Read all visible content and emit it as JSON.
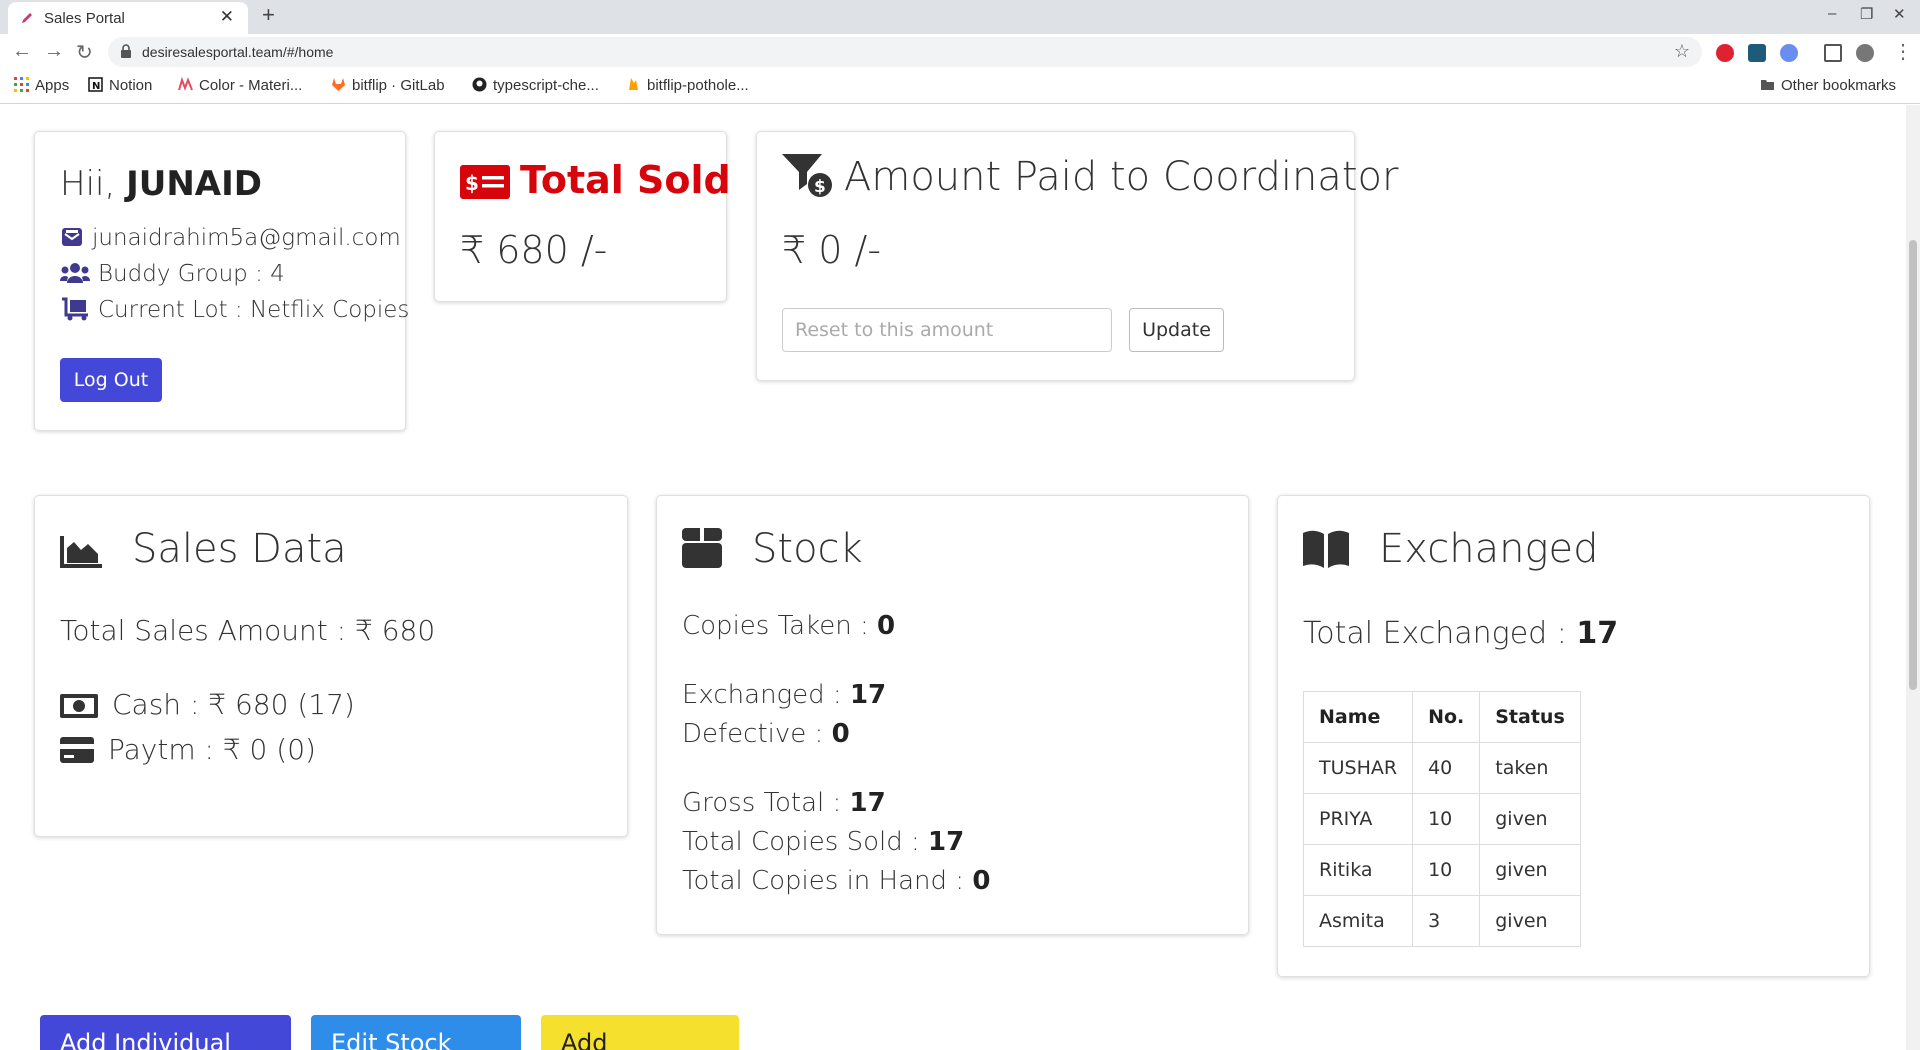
{
  "browser": {
    "tab_title": "Sales Portal",
    "tab_close": "✕",
    "new_tab": "+",
    "url": "desiresalesportal.team/#/home",
    "window_controls": [
      "–",
      "❐",
      "✕"
    ],
    "bookmarks": [
      {
        "label": "Apps",
        "icon": "apps-grid-icon"
      },
      {
        "label": "Notion",
        "icon": "notion-icon"
      },
      {
        "label": "Color - Materi...",
        "icon": "material-color-icon"
      },
      {
        "label": "bitflip · GitLab",
        "icon": "gitlab-icon"
      },
      {
        "label": "typescript-che...",
        "icon": "github-icon"
      },
      {
        "label": "bitflip-pothole...",
        "icon": "firebase-icon"
      }
    ],
    "other_bookmarks": "Other bookmarks"
  },
  "greeting": {
    "prefix": "Hii, ",
    "name": "JUNAID",
    "email": "junaidrahim5a@gmail.com",
    "buddy_group": "Buddy Group : 4",
    "current_lot": "Current Lot : Netflix Copies",
    "logout_label": "Log Out"
  },
  "total_sold": {
    "title": "Total Sold",
    "amount": "₹ 680 /-"
  },
  "coordinator": {
    "title": "Amount Paid to Coordinator",
    "amount": "₹ 0 /-",
    "input_placeholder": "Reset to this amount",
    "update_label": "Update"
  },
  "sales_data": {
    "title": "Sales Data",
    "total_label": "Total Sales Amount : ₹ 680",
    "cash": "Cash : ₹ 680 (17)",
    "paytm": "Paytm : ₹ 0 (0)"
  },
  "stock": {
    "title": "Stock",
    "rows": [
      {
        "label": "Copies Taken : ",
        "value": "0"
      },
      {
        "label": "Exchanged : ",
        "value": "17"
      },
      {
        "label": "Defective : ",
        "value": "0"
      },
      {
        "label": "Gross Total : ",
        "value": "17"
      },
      {
        "label": "Total Copies Sold : ",
        "value": "17"
      },
      {
        "label": "Total Copies in Hand : ",
        "value": "0"
      }
    ]
  },
  "exchanged": {
    "title": "Exchanged",
    "total_label": "Total Exchanged : ",
    "total_value": "17",
    "columns": [
      "Name",
      "No.",
      "Status"
    ],
    "rows": [
      [
        "TUSHAR",
        "40",
        "taken"
      ],
      [
        "PRIYA",
        "10",
        "given"
      ],
      [
        "Ritika",
        "10",
        "given"
      ],
      [
        "Asmita",
        "3",
        "given"
      ]
    ]
  },
  "actions": {
    "add_sale": "Add Individual Sale",
    "edit_stock": "Edit Stock Data",
    "add_exchange": "Add Exchange"
  },
  "colors": {
    "primary": "#4348d8",
    "danger": "#d8040b",
    "info": "#2e8de8",
    "warning": "#f5e12d",
    "icon": "#3f3a8e"
  }
}
